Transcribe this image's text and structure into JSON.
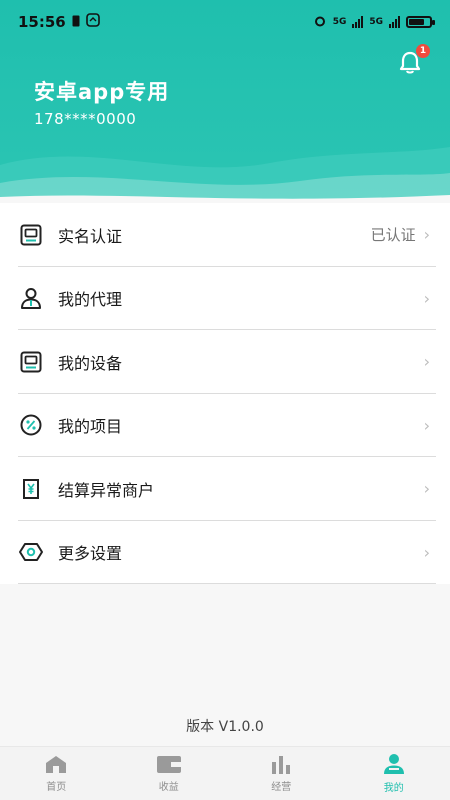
{
  "status_bar": {
    "time": "15:56",
    "net1": "5G",
    "net2": "5G"
  },
  "notification": {
    "badge_count": "1"
  },
  "user": {
    "name": "安卓app专用",
    "phone": "178****0000"
  },
  "menu": {
    "items": [
      {
        "label": "实名认证",
        "value": "已认证",
        "icon": "id-card-icon"
      },
      {
        "label": "我的代理",
        "value": "",
        "icon": "agent-icon"
      },
      {
        "label": "我的设备",
        "value": "",
        "icon": "device-icon"
      },
      {
        "label": "我的项目",
        "value": "",
        "icon": "percent-icon"
      },
      {
        "label": "结算异常商户",
        "value": "",
        "icon": "yuan-icon"
      },
      {
        "label": "更多设置",
        "value": "",
        "icon": "settings-icon"
      }
    ]
  },
  "footer": {
    "version": "版本 V1.0.0"
  },
  "tabbar": {
    "tabs": [
      {
        "label": "首页",
        "icon": "home-icon"
      },
      {
        "label": "收益",
        "icon": "wallet-icon"
      },
      {
        "label": "经营",
        "icon": "bar-chart-icon"
      },
      {
        "label": "我的",
        "icon": "user-icon",
        "active": true
      }
    ]
  },
  "colors": {
    "accent": "#1fbfae",
    "badge": "#f04b3e"
  }
}
